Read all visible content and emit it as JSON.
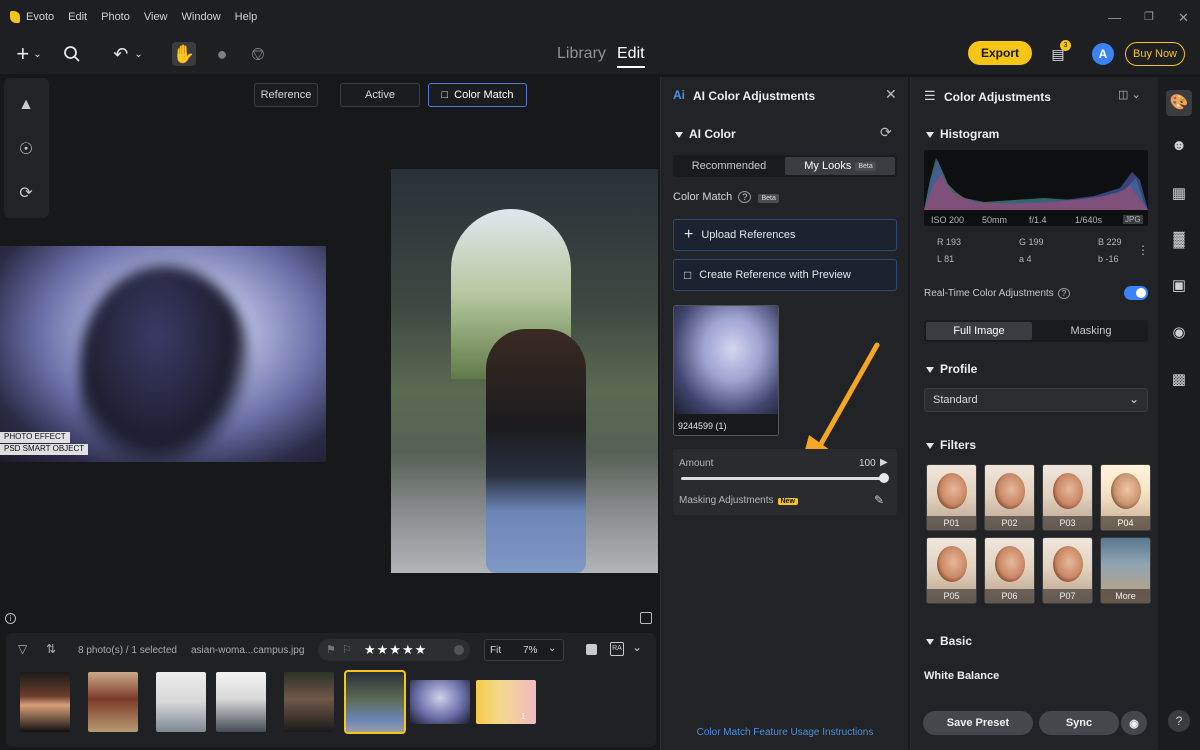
{
  "menubar": {
    "app": "Evoto",
    "items": [
      "Edit",
      "Photo",
      "View",
      "Window",
      "Help"
    ]
  },
  "toolbar": {
    "modes": {
      "library": "Library",
      "edit": "Edit"
    },
    "export": "Export",
    "badge": "3",
    "avatar": "A",
    "buy_now": "Buy Now"
  },
  "view_tabs": {
    "reference": "Reference",
    "active": "Active",
    "color_match": "Color Match"
  },
  "reference_photo": {
    "tag1": "PHOTO EFFECT",
    "tag2": "PSD SMART OBJECT"
  },
  "filmstrip": {
    "count": "8 photo(s) / 1 selected",
    "filename": "asian-woma...campus.jpg",
    "zoom_fit": "Fit",
    "zoom_value": "7%",
    "ra_label": "RA",
    "star_rating": 5,
    "thumb_badge": "1"
  },
  "ai_panel": {
    "title": "AI Color Adjustments",
    "section": "AI Color",
    "tabs": {
      "recommended": "Recommended",
      "my_looks": "My Looks",
      "beta": "Beta"
    },
    "color_match": "Color Match",
    "color_match_beta": "Beta",
    "upload": "Upload References",
    "create": "Create Reference with Preview",
    "ref_name": "9244599 (1)",
    "amount_label": "Amount",
    "amount_value": "100",
    "amount_fraction": 1.0,
    "masking": "Masking Adjustments",
    "masking_new": "New",
    "usage_link": "Color Match Feature Usage Instructions"
  },
  "right_panel": {
    "title": "Color Adjustments",
    "histogram": "Histogram",
    "exif": {
      "iso": "ISO 200",
      "focal": "50mm",
      "aperture": "f/1.4",
      "shutter": "1/640s",
      "format": "JPG"
    },
    "rgb": {
      "r": "R 193",
      "g": "G 199",
      "b": "B 229",
      "l": "L 81",
      "a": "a 4",
      "bb": "b -16"
    },
    "realtime": "Real-Time Color Adjustments",
    "realtime_on": true,
    "scope": {
      "full": "Full Image",
      "masking": "Masking"
    },
    "profile": "Profile",
    "profile_value": "Standard",
    "filters": "Filters",
    "filter_items": [
      "P01",
      "P02",
      "P03",
      "P04",
      "P05",
      "P06",
      "P07",
      "More"
    ],
    "basic": "Basic",
    "white_balance": "White Balance",
    "save_preset": "Save Preset",
    "sync": "Sync"
  },
  "colors": {
    "accent": "#f5c518",
    "link": "#4a8fe0",
    "toggle": "#3b82f6"
  }
}
